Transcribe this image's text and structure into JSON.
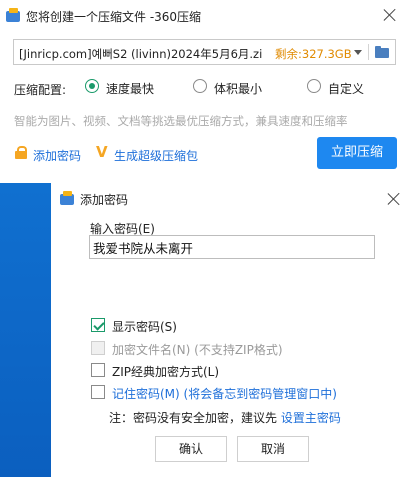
{
  "main_window": {
    "title": "您将创建一个压缩文件 -360压缩",
    "path": {
      "value": "[Jinricp.com]예뻐S2 (livinn)2024年5月6月.zi",
      "free_space": "剩余:327.3GB"
    },
    "config_label": "压缩配置:",
    "options": [
      {
        "label": "速度最快",
        "selected": true
      },
      {
        "label": "体积最小",
        "selected": false
      },
      {
        "label": "自定义",
        "selected": false
      }
    ],
    "hint": "智能为图片、视频、文档等挑选最优压缩方式，兼具速度和压缩率",
    "add_password_link": "添加密码",
    "super_package_link": "生成超级压缩包",
    "compress_button": "立即压缩"
  },
  "dialog": {
    "title": "添加密码",
    "password_label": "输入密码(E)",
    "password_value": "我爱书院从未离开",
    "checkboxes": [
      {
        "label": "显示密码(S)",
        "checked": true,
        "disabled": false
      },
      {
        "label": "加密文件名(N) (不支持ZIP格式)",
        "checked": false,
        "disabled": true
      },
      {
        "label": "ZIP经典加密方式(L)",
        "checked": false,
        "disabled": false
      },
      {
        "label": "记住密码(M) (将会备忘到密码管理窗口中)",
        "checked": false,
        "disabled": false
      }
    ],
    "note_text": "注：密码没有安全加密，建议先 ",
    "note_link": "设置主密码",
    "ok_button": "确认",
    "cancel_button": "取消"
  },
  "colors": {
    "accent_blue": "#1e88f0",
    "link_blue": "#1e6fd9",
    "check_green": "#1a9a6a",
    "free_space_orange": "#e08a00",
    "desktop_blue": "#0f6fd0"
  },
  "icons": [
    "app-icon",
    "close-icon",
    "folder-icon",
    "lock-icon",
    "vip-icon"
  ]
}
